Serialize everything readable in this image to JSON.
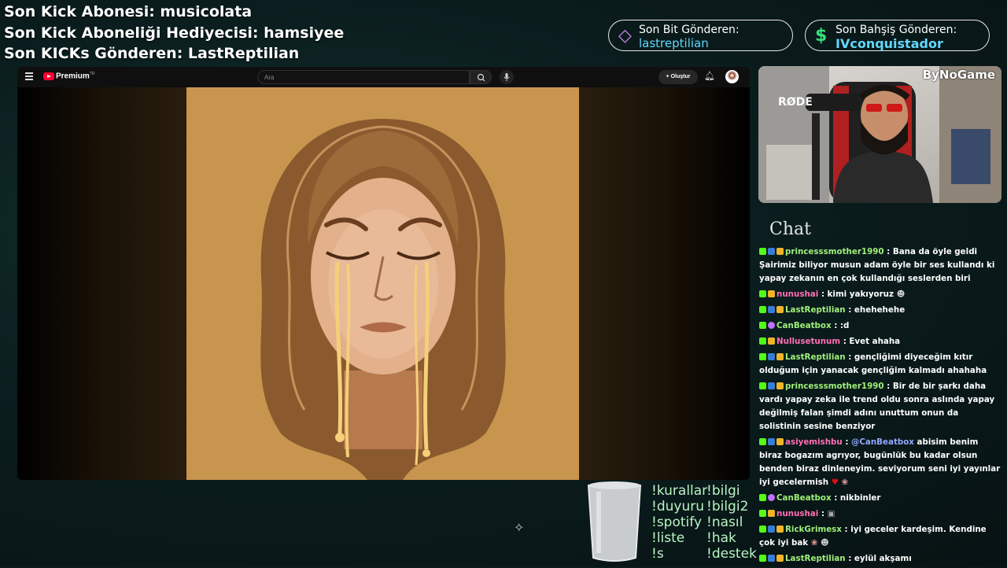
{
  "overlay": {
    "lines": [
      "Son Kick Abonesi: musicolata",
      "Son Kick Aboneliği Hediyecisi: hamsiyee",
      "Son KICKs Gönderen: LastReptilian"
    ]
  },
  "pills": {
    "bits": {
      "label": "Son Bit Gönderen:",
      "value": "lastreptilian",
      "icon": "diamond-icon"
    },
    "bet": {
      "label": "Son Bahşiş Gönderen:",
      "value": "IVconquistador",
      "icon": "dollar-icon"
    }
  },
  "youtube": {
    "brand": "Premium",
    "brand_sup": "TR",
    "search_placeholder": "Ara",
    "create_label": "Oluştur"
  },
  "webcam": {
    "brand": "ByNoGame",
    "mic_label": "RØDE"
  },
  "chat": {
    "title": "Chat",
    "messages": [
      {
        "user": "princesssmother1990",
        "text": ": Bana da öyle geldi Şairimiz biliyor musun adam öyle bir ses kullandı ki yapay zekanın en çok kullandığı seslerden biri"
      },
      {
        "user": "nunushai",
        "text": ": kimi yakıyoruz"
      },
      {
        "user": "LastReptilian",
        "text": ": ehehehehe"
      },
      {
        "user": "CanBeatbox",
        "text": ": :d"
      },
      {
        "user": "Nullusetunum",
        "text": ": Evet ahaha"
      },
      {
        "user": "LastReptilian",
        "text": ": gençliğimi diyeceğim kıtır olduğum için yanacak gençliğim kalmadı ahahaha"
      },
      {
        "user": "princesssmother1990",
        "text": ": Bir de bir şarkı daha vardı yapay zeka ile trend oldu sonra aslında yapay değilmiş falan şimdi adını unuttum onun da solistinin sesine benziyor"
      },
      {
        "user": "asiyemishbu",
        "mention": "@CanBeatbox",
        "text": " abisim benim biraz bogazım agrıyor, bugünlük bu kadar olsun benden biraz dinleneyim. seviyorum seni iyi yayınlar iyi gecelermish"
      },
      {
        "user": "CanBeatbox",
        "text": ": nikbinler"
      },
      {
        "user": "nunushai",
        "text": ":"
      },
      {
        "user": "RickGrimesx",
        "text": ": iyi geceler kardeşim. Kendine çok iyi bak"
      },
      {
        "user": "LastReptilian",
        "text": ": eylül akşamı"
      }
    ]
  },
  "commands": {
    "col1": [
      "!kurallar",
      "!duyuru",
      "!spotify",
      "!liste",
      "!s"
    ],
    "col2": [
      "!bilgi",
      "!bilgi2",
      "!nasıl",
      "!hak",
      "!destek"
    ]
  }
}
